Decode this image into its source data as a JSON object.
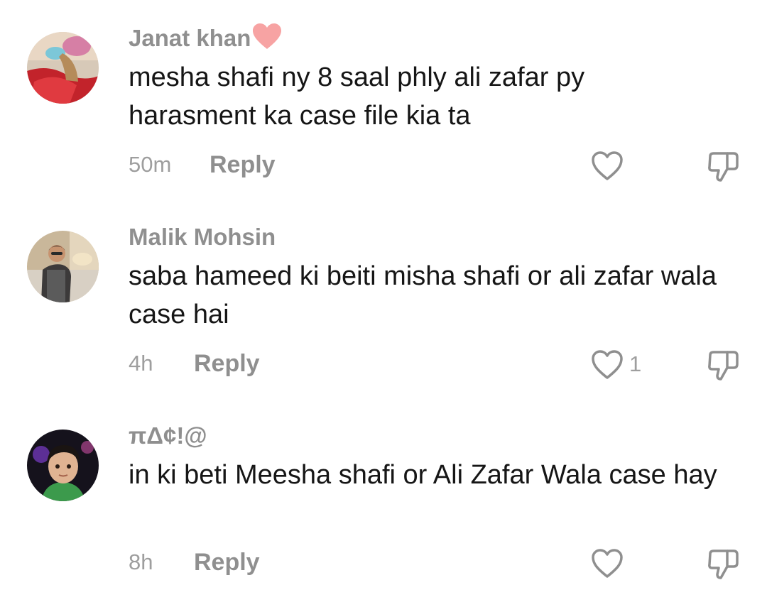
{
  "comments": [
    {
      "username": "Janat khan",
      "username_emoji": "heart-emoji",
      "text": "mesha shafi ny 8 saal phly ali zafar py harasment ka case file kia ta",
      "time": "50m",
      "reply_label": "Reply",
      "like_count": ""
    },
    {
      "username": "Malik Mohsin",
      "text": "saba hameed ki beiti misha shafi or ali zafar wala case hai",
      "time": "4h",
      "reply_label": "Reply",
      "like_count": "1"
    },
    {
      "username": "πΔ¢!@",
      "text": "in ki beti Meesha shafi or Ali Zafar Wala case hay",
      "time": "8h",
      "reply_label": "Reply",
      "like_count": ""
    }
  ],
  "icons": {
    "like": "heart-outline-icon",
    "dislike": "thumbs-down-icon"
  },
  "colors": {
    "username": "#8f8f8f",
    "text": "#161616",
    "meta": "#9e9e9e",
    "heart_emoji": "#f7a3a3"
  }
}
